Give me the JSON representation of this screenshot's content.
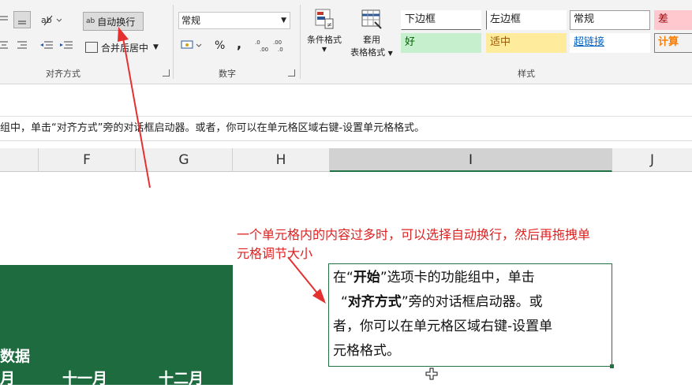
{
  "ribbon": {
    "alignment": {
      "wrap_text_label": "自动换行",
      "merge_center_label": "合并后居中",
      "group_label": "对齐方式"
    },
    "number": {
      "format_value": "常规",
      "percent_symbol": "%",
      "comma_symbol": ",",
      "group_label": "数字"
    },
    "conditional_format": {
      "label": "条件格式"
    },
    "table_format": {
      "label_line1": "套用",
      "label_line2": "表格格式"
    },
    "styles": {
      "group_label": "样式",
      "cells": [
        {
          "label": "下边框"
        },
        {
          "label": "左边框"
        },
        {
          "label": "常规"
        },
        {
          "label": "差"
        },
        {
          "label": "好"
        },
        {
          "label": "适中"
        },
        {
          "label": "超链接"
        },
        {
          "label": "计算"
        }
      ]
    }
  },
  "hint_text": "组中，单击“对齐方式”旁的对话框启动器。或者，你可以在单元格区域右键-设置单元格格式。",
  "columns": [
    "F",
    "G",
    "H",
    "I",
    "J"
  ],
  "green_block": {
    "label": "数据",
    "months": [
      "月",
      "十一月",
      "十二月"
    ]
  },
  "annotation": {
    "line1": "一个单元格内的内容过多时，可以选择自动换行，然后再拖拽单",
    "line2": "元格调节大小"
  },
  "cell_I": {
    "p1": "在“",
    "b1": "开始",
    "p2": "”选项卡的功能组中，单击",
    "p3": "“",
    "b2": "对齐方式",
    "p4": "”旁的对话框启动器。或",
    "p5": "者，你可以在单元格区域右键-设置单",
    "p6": "元格格式。"
  },
  "colors": {
    "excel_green": "#217346",
    "annotation_red": "#e02020",
    "block_green": "#1e6b40"
  }
}
